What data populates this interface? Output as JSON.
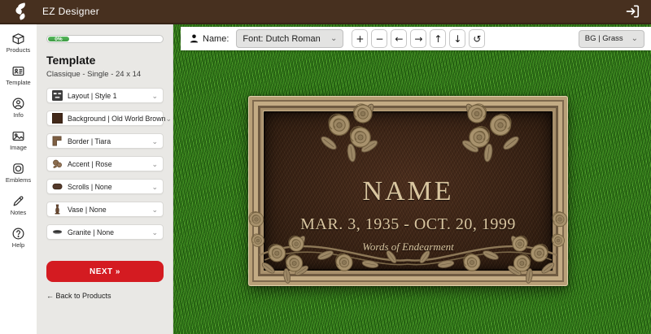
{
  "topbar": {
    "title": "EZ Designer"
  },
  "nav": {
    "items": [
      {
        "label": "Products"
      },
      {
        "label": "Template"
      },
      {
        "label": "Info"
      },
      {
        "label": "Image"
      },
      {
        "label": "Emblems"
      },
      {
        "label": "Notes"
      },
      {
        "label": "Help"
      }
    ]
  },
  "panel": {
    "progress_label": "0%",
    "title": "Template",
    "subtitle": "Classique - Single - 24 x 14",
    "options": [
      {
        "label": "Layout | Style 1"
      },
      {
        "label": "Background | Old World Brown"
      },
      {
        "label": "Border | Tiara"
      },
      {
        "label": "Accent | Rose"
      },
      {
        "label": "Scrolls | None"
      },
      {
        "label": "Vase | None"
      },
      {
        "label": "Granite | None"
      }
    ],
    "next_label": "NEXT »",
    "back_label": "← Back to Products"
  },
  "toolbar": {
    "name_label": "Name:",
    "font_value": "Font: Dutch Roman",
    "buttons": [
      {
        "glyph": "+"
      },
      {
        "glyph": "−"
      },
      {
        "glyph": "←"
      },
      {
        "glyph": "→"
      },
      {
        "glyph": "↑"
      },
      {
        "glyph": "↓"
      },
      {
        "glyph": "↺"
      }
    ],
    "bg_value": "BG | Grass"
  },
  "plaque": {
    "name": "NAME",
    "dates": "MAR. 3, 1935 - OCT. 20, 1999",
    "endearment": "Words of Endearment"
  },
  "colors": {
    "topbar_brown": "#47301f",
    "accent_red": "#d41b21",
    "progress_green": "#3d9b43",
    "grass_green": "#38811f",
    "frame_tan": "#b29a72",
    "plaque_brown": "#3a2315",
    "engraving_tan": "#dac6a0"
  },
  "glyphs": {
    "chevron": "⌄"
  }
}
